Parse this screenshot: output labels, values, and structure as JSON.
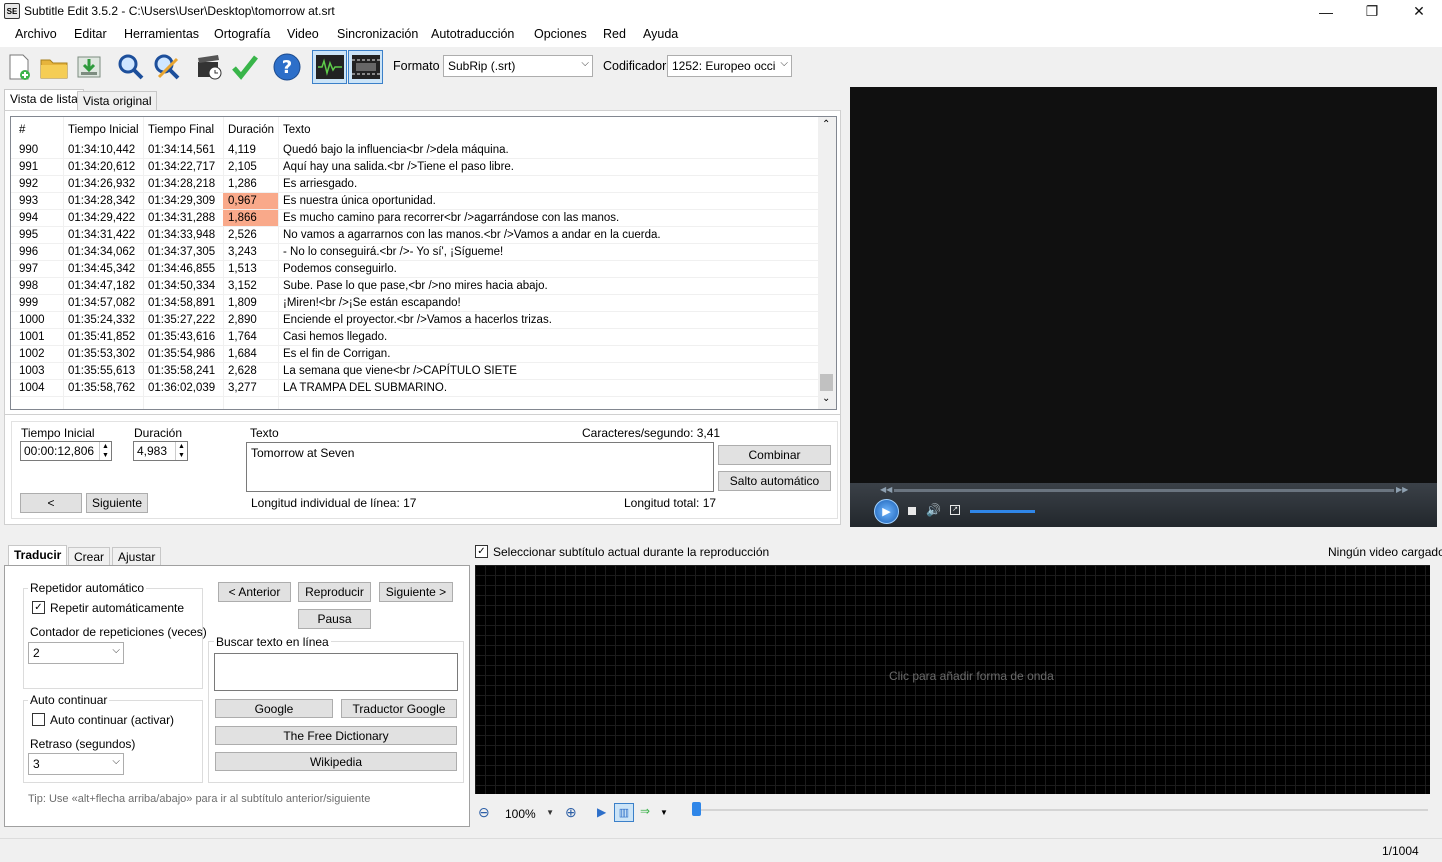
{
  "window": {
    "title": "Subtitle Edit 3.5.2 - C:\\Users\\User\\Desktop\\tomorrow at.srt",
    "icon_text": "SE"
  },
  "menu": [
    "Archivo",
    "Editar",
    "Herramientas",
    "Ortografía",
    "Video",
    "Sincronización",
    "Autotraducción",
    "Opciones",
    "Red",
    "Ayuda"
  ],
  "toolbar": {
    "format_label": "Formato",
    "format_value": "SubRip (.srt)",
    "encoding_label": "Codificador",
    "encoding_value": "1252: Europeo occi"
  },
  "tabs": {
    "list_view": "Vista de lista",
    "original_view": "Vista original"
  },
  "list": {
    "headers": [
      "#",
      "Tiempo Inicial",
      "Tiempo Final",
      "Duración",
      "Texto"
    ],
    "rows": [
      {
        "n": "990",
        "start": "01:34:10,442",
        "end": "01:34:14,561",
        "dur": "4,119",
        "text": "Quedó bajo la influencia<br />dela máquina."
      },
      {
        "n": "991",
        "start": "01:34:20,612",
        "end": "01:34:22,717",
        "dur": "2,105",
        "text": "Aquí hay una salida.<br />Tiene el paso libre."
      },
      {
        "n": "992",
        "start": "01:34:26,932",
        "end": "01:34:28,218",
        "dur": "1,286",
        "text": "Es arriesgado."
      },
      {
        "n": "993",
        "start": "01:34:28,342",
        "end": "01:34:29,309",
        "dur": "0,967",
        "text": "Es nuestra única oportunidad."
      },
      {
        "n": "994",
        "start": "01:34:29,422",
        "end": "01:34:31,288",
        "dur": "1,866",
        "text": "Es mucho camino para recorrer<br />agarrándose con las manos."
      },
      {
        "n": "995",
        "start": "01:34:31,422",
        "end": "01:34:33,948",
        "dur": "2,526",
        "text": "No vamos a agarrarnos con las manos.<br />Vamos a andar en la cuerda."
      },
      {
        "n": "996",
        "start": "01:34:34,062",
        "end": "01:34:37,305",
        "dur": "3,243",
        "text": "- No lo conseguirá.<br />- Yo sí', ¡Sígueme!"
      },
      {
        "n": "997",
        "start": "01:34:45,342",
        "end": "01:34:46,855",
        "dur": "1,513",
        "text": "Podemos conseguirlo."
      },
      {
        "n": "998",
        "start": "01:34:47,182",
        "end": "01:34:50,334",
        "dur": "3,152",
        "text": "Sube. Pase lo que pase,<br />no mires hacia abajo."
      },
      {
        "n": "999",
        "start": "01:34:57,082",
        "end": "01:34:58,891",
        "dur": "1,809",
        "text": "¡Miren!<br />¡Se están escapando!"
      },
      {
        "n": "1000",
        "start": "01:35:24,332",
        "end": "01:35:27,222",
        "dur": "2,890",
        "text": "Enciende el proyector.<br />Vamos a hacerlos trizas."
      },
      {
        "n": "1001",
        "start": "01:35:41,852",
        "end": "01:35:43,616",
        "dur": "1,764",
        "text": "Casi hemos llegado."
      },
      {
        "n": "1002",
        "start": "01:35:53,302",
        "end": "01:35:54,986",
        "dur": "1,684",
        "text": "Es el fin de Corrigan."
      },
      {
        "n": "1003",
        "start": "01:35:55,613",
        "end": "01:35:58,241",
        "dur": "2,628",
        "text": "La semana que viene<br />CAPÍTULO SIETE"
      },
      {
        "n": "1004",
        "start": "01:35:58,762",
        "end": "01:36:02,039",
        "dur": "3,277",
        "text": "LA TRAMPA DEL SUBMARINO."
      }
    ],
    "highlight_color": "#f9a98a"
  },
  "edit": {
    "start_label": "Tiempo Inicial",
    "start_value": "00:00:12,806",
    "duration_label": "Duración",
    "duration_value": "4,983",
    "text_label": "Texto",
    "cps": "Caracteres/segundo: 3,41",
    "text_value": "Tomorrow at Seven",
    "combine": "Combinar",
    "auto_break": "Salto automático",
    "prev": "<",
    "next": "Siguiente",
    "line_length": "Longitud individual de línea: 17",
    "total_length": "Longitud total: 17"
  },
  "bottom_tabs": [
    "Traducir",
    "Crear",
    "Ajustar"
  ],
  "translate": {
    "auto_repeat_title": "Repetidor automático",
    "auto_repeat_check": "Repetir automáticamente",
    "repeat_count_label": "Contador de repeticiones (veces)",
    "repeat_count": "2",
    "auto_continue_title": "Auto continuar",
    "auto_continue_check": "Auto continuar (activar)",
    "delay_label": "Retraso (segundos)",
    "delay": "3",
    "prev_btn": "< Anterior",
    "play_btn": "Reproducir",
    "next_btn": "Siguiente >",
    "pause_btn": "Pausa",
    "search_title": "Buscar texto en línea",
    "google": "Google",
    "google_translate": "Traductor Google",
    "free_dictionary": "The Free Dictionary",
    "wikipedia": "Wikipedia",
    "tip": "Tip: Use «alt+flecha arriba/abajo» para ir al subtítulo anterior/siguiente"
  },
  "waveform": {
    "select_current": "Seleccionar subtítulo actual durante la reproducción",
    "no_video": "Ningún video cargado",
    "click_hint": "Clic para añadir forma de onda",
    "zoom": "100%"
  },
  "status": {
    "position": "1/1004"
  }
}
